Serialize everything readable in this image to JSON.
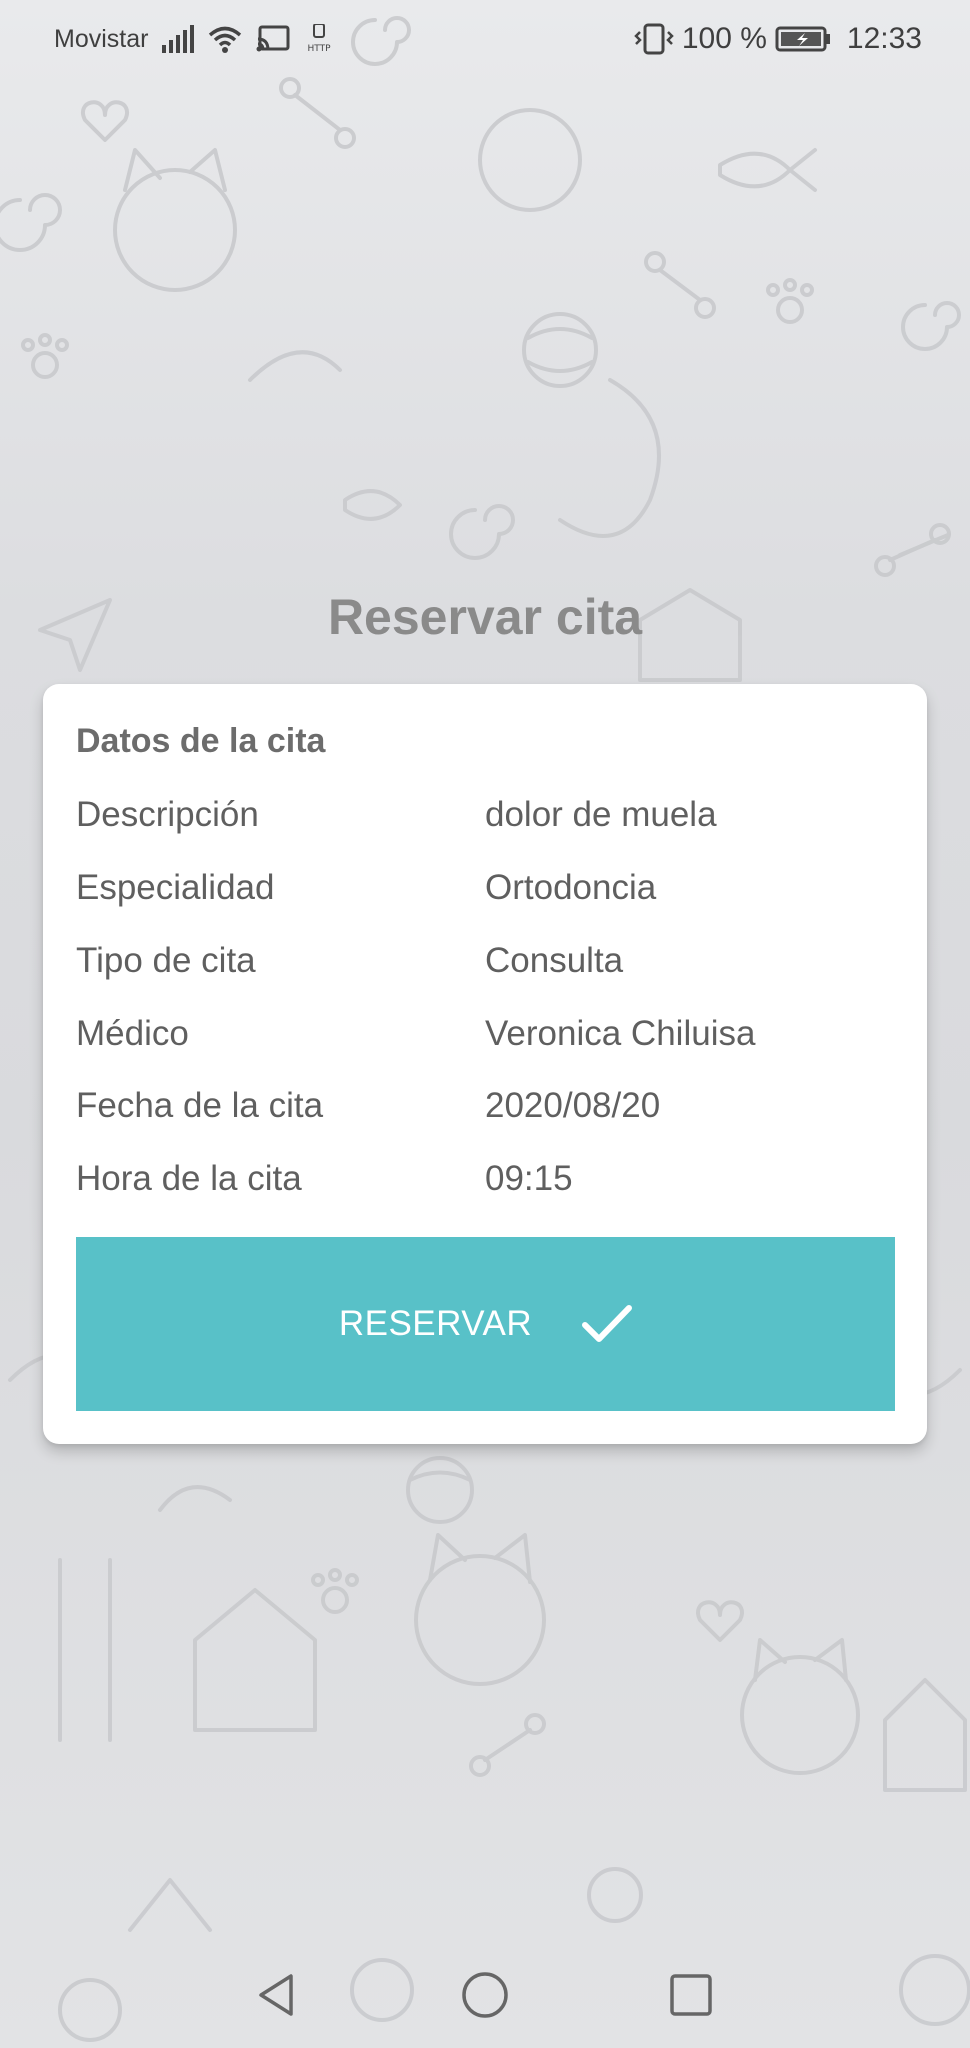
{
  "status_bar": {
    "carrier": "Movistar",
    "battery": "100 %",
    "time": "12:33",
    "icons": [
      "signal-icon",
      "wifi-icon",
      "cast-icon",
      "http-icon",
      "vibrate-icon",
      "battery-icon"
    ]
  },
  "page": {
    "title": "Reservar cita"
  },
  "card": {
    "heading": "Datos de la cita",
    "rows": [
      {
        "label": "Descripción",
        "value": "dolor de muela"
      },
      {
        "label": "Especialidad",
        "value": "Ortodoncia"
      },
      {
        "label": "Tipo de cita",
        "value": "Consulta"
      },
      {
        "label": "Médico",
        "value": "Veronica Chiluisa"
      },
      {
        "label": "Fecha de la cita",
        "value": "2020/08/20"
      },
      {
        "label": "Hora de la cita",
        "value": "09:15"
      }
    ],
    "button": {
      "label": "RESERVAR",
      "icon": "check-icon",
      "color": "#58c1c8"
    }
  },
  "nav_bar": {
    "icons": [
      "back-icon",
      "home-icon",
      "recents-icon"
    ]
  },
  "colors": {
    "background": "#dcdde0",
    "title": "#8a8a8a",
    "text": "#5f5f5f",
    "accent": "#58c1c8"
  }
}
